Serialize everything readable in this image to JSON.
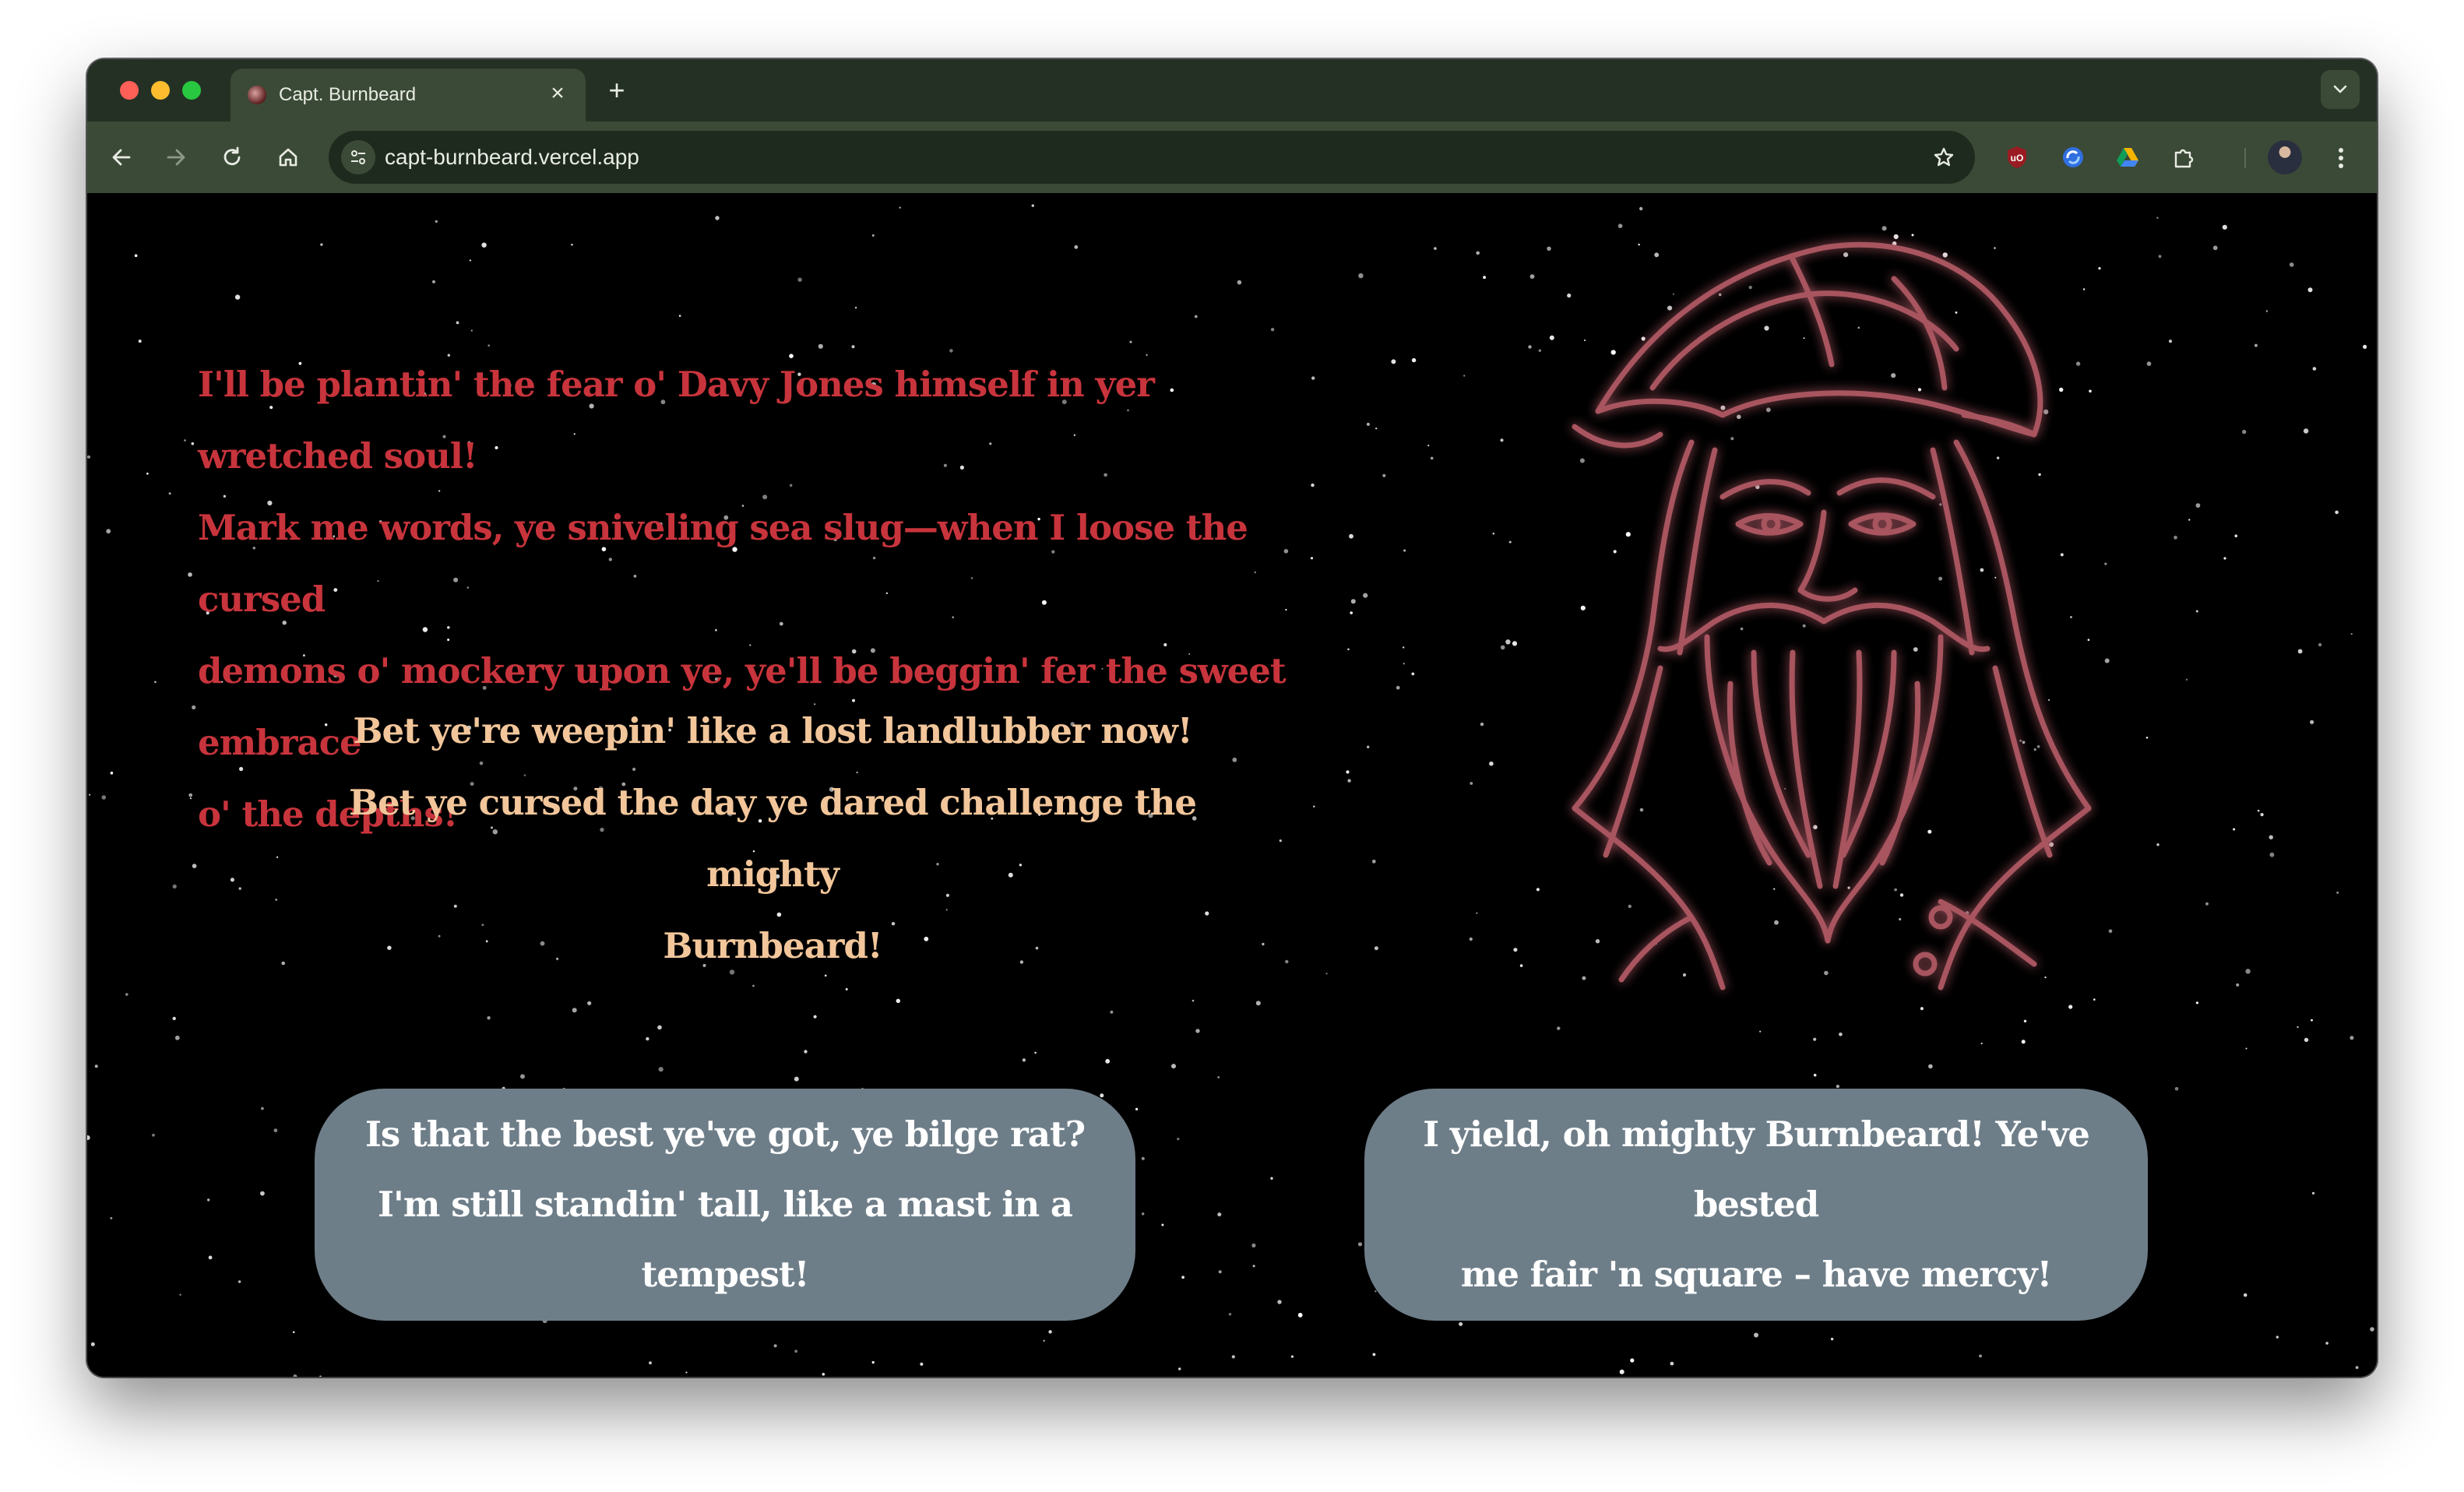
{
  "browser": {
    "tab": {
      "title": "Capt. Burnbeard",
      "close_glyph": "×",
      "favicon": "pirate-favicon"
    },
    "new_tab_glyph": "+",
    "address_bar": {
      "url": "capt-burnbeard.vercel.app"
    },
    "extensions": [
      "ublock-icon",
      "sync-icon",
      "drive-icon",
      "puzzle-icon"
    ]
  },
  "page": {
    "taunt_lines": [
      "I'll be plantin' the fear o' Davy Jones himself in yer wretched soul!",
      "Mark me words, ye sniveling sea slug—when I loose the cursed",
      "demons o' mockery upon ye, ye'll be beggin' fer the sweet embrace",
      "o' the depths!"
    ],
    "brag_lines": [
      "Bet ye're weepin' like a lost landlubber now!",
      "Bet ye cursed the day ye dared challenge the mighty",
      "Burnbeard!"
    ],
    "replies": {
      "defy": [
        "Is that the best ye've got, ye bilge rat?",
        "I'm still standin' tall, like a mast in a tempest!"
      ],
      "yield": [
        "I yield, oh mighty Burnbeard! Ye've bested",
        "me fair 'n square – have mercy!"
      ]
    }
  },
  "colors": {
    "taunt": "#c8343c",
    "brag": "#f2c69a",
    "reply_bg": "#6e7e89",
    "pirate_outline": "#a85560",
    "chrome_dark": "#243024",
    "chrome_mid": "#3b4a36"
  }
}
